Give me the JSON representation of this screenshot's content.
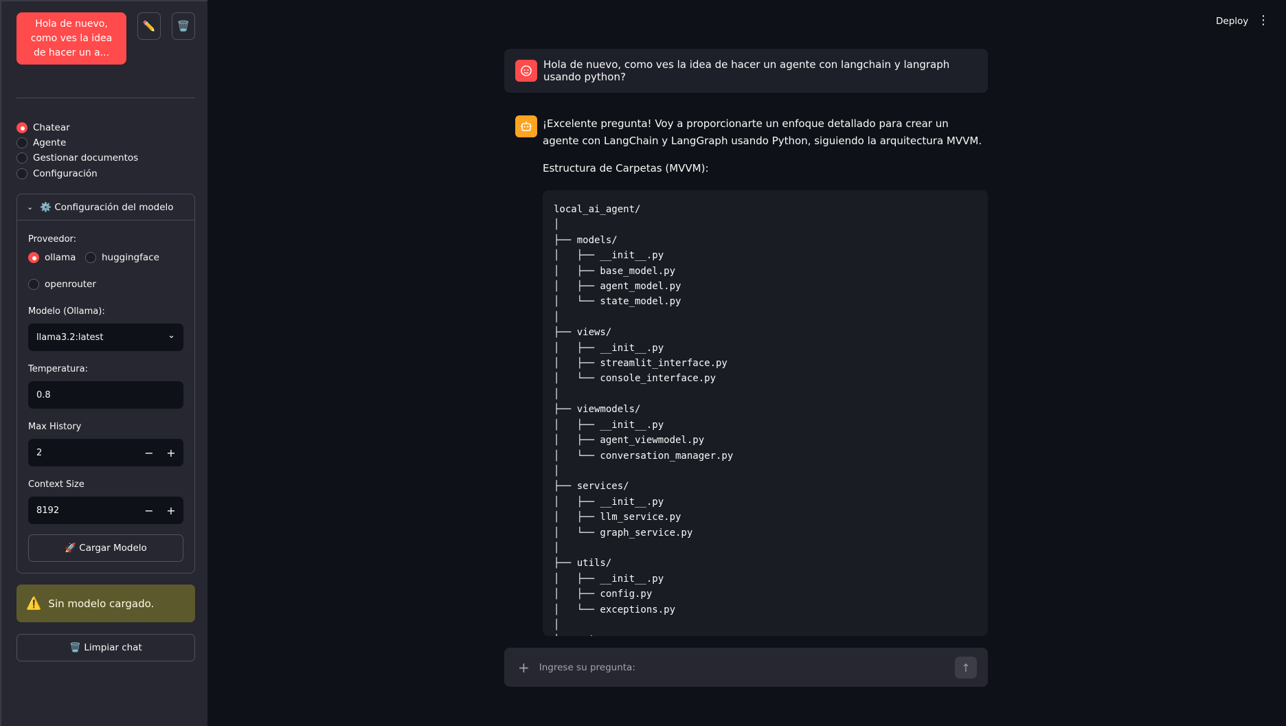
{
  "sidebar": {
    "chat_title": "Hola de nuevo, como ves la idea de hacer un a...",
    "edit_icon": "pencil-icon",
    "delete_icon": "trash-icon",
    "nav": [
      {
        "label": "Chatear",
        "selected": true
      },
      {
        "label": "Agente",
        "selected": false
      },
      {
        "label": "Gestionar documentos",
        "selected": false
      },
      {
        "label": "Configuración",
        "selected": false
      }
    ],
    "expander_title": "⚙️ Configuración del modelo",
    "provider_label": "Proveedor:",
    "providers": [
      {
        "label": "ollama",
        "selected": true
      },
      {
        "label": "huggingface",
        "selected": false
      },
      {
        "label": "openrouter",
        "selected": false
      }
    ],
    "model_label": "Modelo (Ollama):",
    "model_value": "llama3.2:latest",
    "temperature_label": "Temperatura:",
    "temperature_value": "0.8",
    "max_history_label": "Max History",
    "max_history_value": "2",
    "context_size_label": "Context Size",
    "context_size_value": "8192",
    "load_button": "🚀 Cargar Modelo",
    "warning_icon": "⚠️",
    "warning_text": "Sin modelo cargado.",
    "clear_button": "🗑️ Limpiar chat"
  },
  "header": {
    "deploy": "Deploy",
    "menu_icon": "⋮"
  },
  "chat": {
    "user_message": "Hola de nuevo, como ves la idea de hacer un agente con langchain y langraph usando python?",
    "bot_message": "¡Excelente pregunta! Voy a proporcionarte un enfoque detallado para crear un agente con LangChain y LangGraph usando Python, siguiendo la arquitectura MVVM.",
    "bot_subheading": "Estructura de Carpetas (MVVM):",
    "code": "local_ai_agent/\n│\n├── models/\n│   ├── __init__.py\n│   ├── base_model.py\n│   ├── agent_model.py\n│   └── state_model.py\n│\n├── views/\n│   ├── __init__.py\n│   ├── streamlit_interface.py\n│   └── console_interface.py\n│\n├── viewmodels/\n│   ├── __init__.py\n│   ├── agent_viewmodel.py\n│   └── conversation_manager.py\n│\n├── services/\n│   ├── __init__.py\n│   ├── llm_service.py\n│   └── graph_service.py\n│\n├── utils/\n│   ├── __init__.py\n│   ├── config.py\n│   └── exceptions.py\n│\n├── main.py"
  },
  "input": {
    "placeholder": "Ingrese su pregunta:"
  }
}
